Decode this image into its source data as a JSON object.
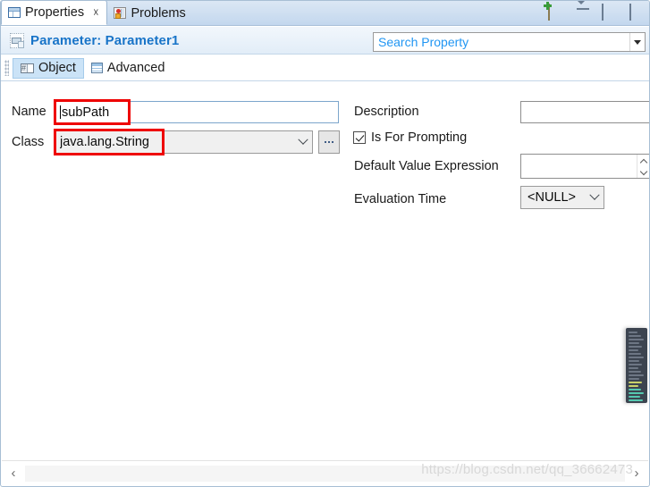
{
  "window": {
    "view_tabs": [
      {
        "label": "Properties",
        "icon": "grid-icon",
        "active": true,
        "closable": true
      },
      {
        "label": "Problems",
        "icon": "problems-icon",
        "active": false,
        "closable": false
      }
    ],
    "toolbar": [
      {
        "name": "pin-view-icon",
        "title": "New Properties View"
      },
      {
        "name": "view-menu-icon",
        "title": "View Menu"
      },
      {
        "name": "minimize-icon",
        "title": "Minimize"
      },
      {
        "name": "maximize-icon",
        "title": "Maximize"
      }
    ]
  },
  "header": {
    "title": "Parameter: Parameter1",
    "title_color": "#1874c8",
    "icon": "parameter-icon"
  },
  "search": {
    "placeholder": "Search Property",
    "value": "",
    "placeholder_color": "#2196f3"
  },
  "section_tabs": [
    {
      "label": "Object",
      "icon": "object-tab-icon",
      "active": true
    },
    {
      "label": "Advanced",
      "icon": "advanced-tab-icon",
      "active": false
    }
  ],
  "form": {
    "left": {
      "name": {
        "label": "Name",
        "value": "subPath",
        "highlighted": true
      },
      "class": {
        "label": "Class",
        "value": "java.lang.String",
        "highlighted": true,
        "browse_button": "...",
        "options": [
          "java.lang.String"
        ]
      }
    },
    "right": {
      "description": {
        "label": "Description",
        "value": ""
      },
      "is_for_prompting": {
        "label": "Is For Prompting",
        "checked": true
      },
      "default_value_expression": {
        "label": "Default Value Expression",
        "value": ""
      },
      "evaluation_time": {
        "label": "Evaluation Time",
        "value": "<NULL>",
        "options": [
          "<NULL>"
        ]
      }
    }
  },
  "annotations": {
    "highlight_color": "#ee0000",
    "boxes": [
      {
        "target": "name-value",
        "label": "subPath"
      },
      {
        "target": "class-value",
        "label": "java.lang.String"
      }
    ]
  },
  "scrollbar": {
    "left_arrow": "‹",
    "right_arrow": "›"
  },
  "watermark": "https://blog.csdn.net/qq_36662473",
  "minimap": {
    "lines": [
      "#6d7684",
      "#6d7684",
      "#6d7684",
      "#6d7684",
      "#6d7684",
      "#6d7684",
      "#6d7684",
      "#6d7684",
      "#6d7684",
      "#6d7684",
      "#6d7684",
      "#6d7684",
      "#6d7684",
      "#6d7684",
      "#c9d16a",
      "#c9d16a",
      "#55c8b0",
      "#55c8b0",
      "#55c8b0",
      "#55c8b0",
      "#55c8b0",
      "#55c8b0"
    ]
  }
}
